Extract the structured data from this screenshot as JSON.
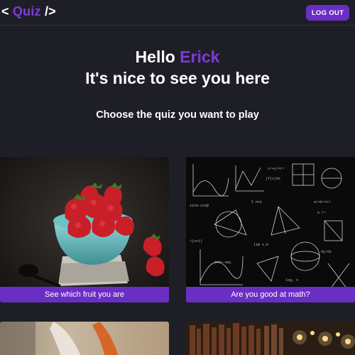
{
  "header": {
    "logo_open": "<",
    "logo_word": "Quiz",
    "logo_close": "/>",
    "logout_label": "LOG OUT"
  },
  "greeting": {
    "hello": "Hello",
    "name": "Erick",
    "subtitle": "It's nice to see you here",
    "prompt": "Choose the quiz you want to play"
  },
  "quizzes": [
    {
      "label": "See which fruit you are"
    },
    {
      "label": "Are you good at math?"
    },
    {
      "label": ""
    },
    {
      "label": ""
    }
  ],
  "colors": {
    "background": "#1e1f26",
    "accent": "#7c3cd8",
    "button": "#6a2ec4",
    "text": "#ffffff"
  }
}
